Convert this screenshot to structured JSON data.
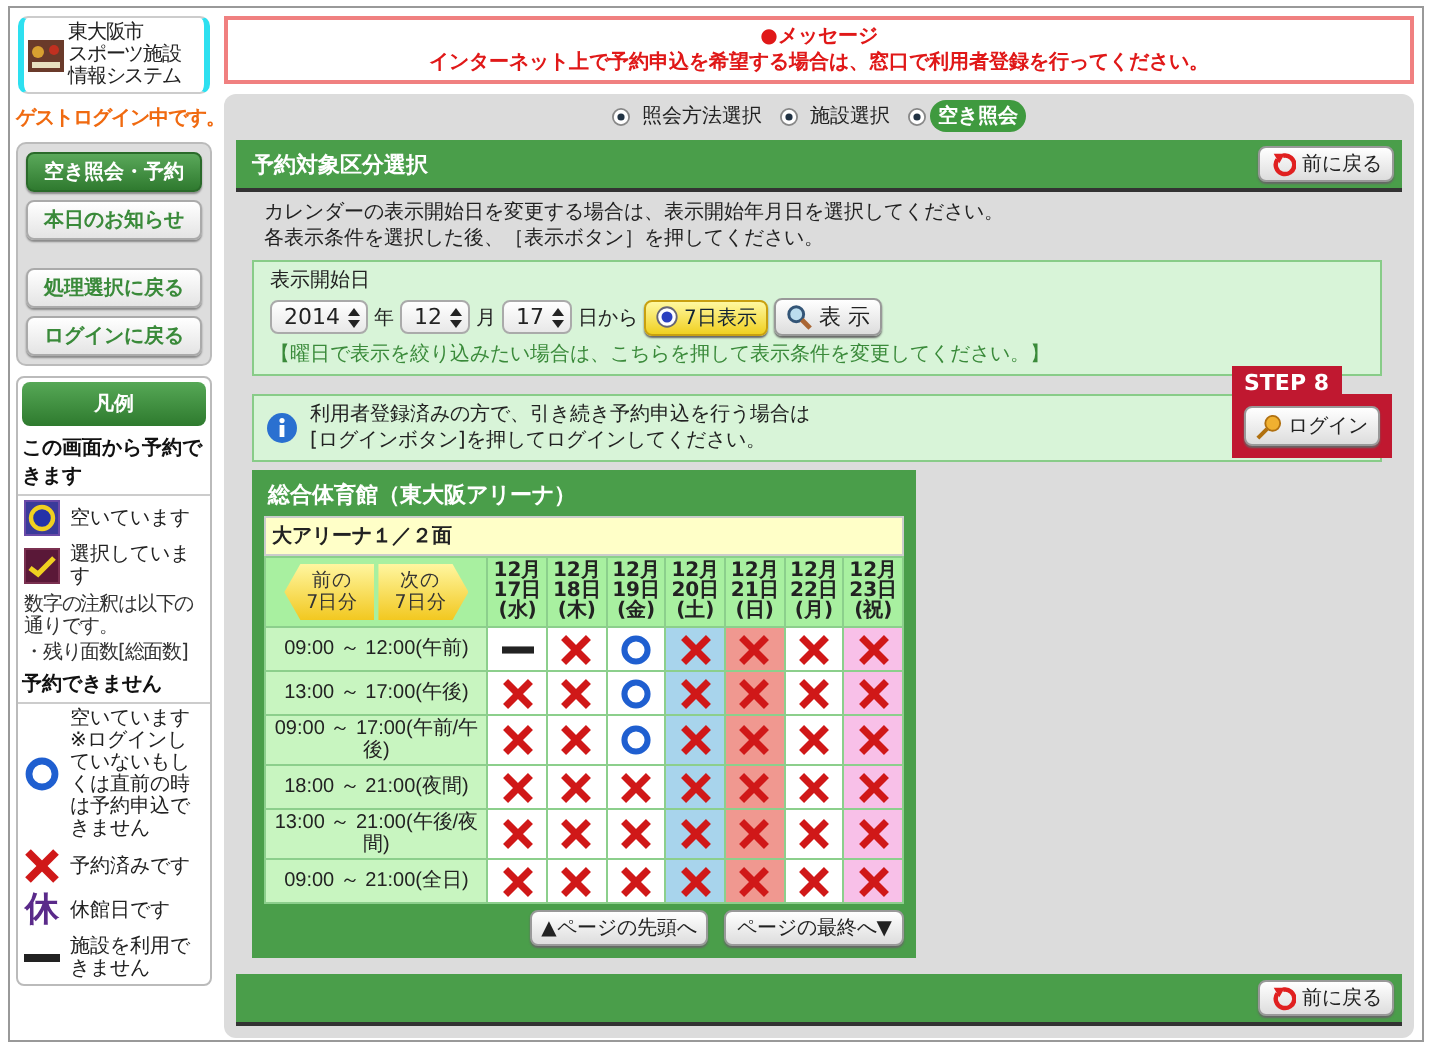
{
  "logo": {
    "lines": [
      "東大阪市",
      "スポーツ施設",
      "情報システム"
    ]
  },
  "guest_status": "ゲストログイン中です。",
  "nav_groups": [
    [
      {
        "label": "空き照会・予約",
        "selected": true
      },
      {
        "label": "本日のお知らせ",
        "selected": false
      }
    ],
    [
      {
        "label": "処理選択に戻る",
        "selected": false
      },
      {
        "label": "ログインに戻る",
        "selected": false
      }
    ]
  ],
  "legend": {
    "title": "凡例",
    "sections": [
      {
        "heading": "この画面から予約できます",
        "items": [
          {
            "kind": "vacant_box",
            "text": "空いています"
          },
          {
            "kind": "selected_box",
            "text": "選択しています"
          }
        ],
        "notes": [
          "数字の注釈は以下の通りです。",
          "・残り面数[総面数]"
        ]
      },
      {
        "heading": "予約できません",
        "items": [
          {
            "kind": "circle",
            "text": "空いています ※ログインしていないもしくは直前の時は予約申込できません"
          },
          {
            "kind": "cross",
            "text": "予約済みです"
          },
          {
            "kind": "closed",
            "symbol": "休",
            "text": "休館日です"
          },
          {
            "kind": "dash",
            "text": "施設を利用できません"
          }
        ]
      }
    ]
  },
  "message": {
    "title": "●メッセージ",
    "text": "インターネット上で予約申込を希望する場合は、窓口で利用者登録を行ってください。"
  },
  "steps": [
    {
      "label": "照会方法選択",
      "selected": false
    },
    {
      "label": "施設選択",
      "selected": false
    },
    {
      "label": "空き照会",
      "selected": true
    }
  ],
  "section_title": "予約対象区分選択",
  "back_button": "前に戻る",
  "instructions": [
    "カレンダーの表示開始日を変更する場合は、表示開始年月日を選択してください。",
    "各表示条件を選択した後、［表示ボタン］を押してください。"
  ],
  "date_form": {
    "label": "表示開始日",
    "year": "2014",
    "year_unit": "年",
    "month": "12",
    "month_unit": "月",
    "day": "17",
    "day_unit": "日から",
    "mode_button": "7日表示",
    "mode_selected": true,
    "show_button": "表 示",
    "filter_link": "【曜日で表示を絞り込みたい場合は、こちらを押して表示条件を変更してください。】"
  },
  "login_notice": {
    "lines": [
      "利用者登録済みの方で、引き続き予約申込を行う場合は",
      "[ログインボタン]を押してログインしてください。"
    ],
    "step_badge": "STEP 8",
    "login_button": "ログイン"
  },
  "calendar": {
    "facility": "総合体育館（東大阪アリーナ）",
    "room": "大アリーナ１／２面",
    "prev_button": [
      "前の",
      "7日分"
    ],
    "next_button": [
      "次の",
      "7日分"
    ],
    "days": [
      {
        "month": "12月",
        "day": "17日",
        "weekday": "(水)",
        "kind": "weekday"
      },
      {
        "month": "12月",
        "day": "18日",
        "weekday": "(木)",
        "kind": "weekday"
      },
      {
        "month": "12月",
        "day": "19日",
        "weekday": "(金)",
        "kind": "weekday"
      },
      {
        "month": "12月",
        "day": "20日",
        "weekday": "(土)",
        "kind": "saturday"
      },
      {
        "month": "12月",
        "day": "21日",
        "weekday": "(日)",
        "kind": "sunday"
      },
      {
        "month": "12月",
        "day": "22日",
        "weekday": "(月)",
        "kind": "weekday"
      },
      {
        "month": "12月",
        "day": "23日",
        "weekday": "(祝)",
        "kind": "holiday"
      }
    ],
    "rows": [
      {
        "time": "09:00 ～ 12:00(午前)",
        "cells": [
          {
            "kind": "dash"
          },
          {
            "kind": "cross"
          },
          {
            "kind": "circle"
          },
          {
            "kind": "cross"
          },
          {
            "kind": "cross"
          },
          {
            "kind": "cross"
          },
          {
            "kind": "cross"
          }
        ]
      },
      {
        "time": "13:00 ～ 17:00(午後)",
        "cells": [
          {
            "kind": "cross"
          },
          {
            "kind": "cross"
          },
          {
            "kind": "circle"
          },
          {
            "kind": "cross"
          },
          {
            "kind": "cross"
          },
          {
            "kind": "cross"
          },
          {
            "kind": "cross"
          }
        ]
      },
      {
        "time": "09:00 ～ 17:00(午前/午後)",
        "cells": [
          {
            "kind": "cross"
          },
          {
            "kind": "cross"
          },
          {
            "kind": "circle"
          },
          {
            "kind": "cross"
          },
          {
            "kind": "cross"
          },
          {
            "kind": "cross"
          },
          {
            "kind": "cross"
          }
        ]
      },
      {
        "time": "18:00 ～ 21:00(夜間)",
        "cells": [
          {
            "kind": "cross"
          },
          {
            "kind": "cross"
          },
          {
            "kind": "cross"
          },
          {
            "kind": "cross"
          },
          {
            "kind": "cross"
          },
          {
            "kind": "cross"
          },
          {
            "kind": "cross"
          }
        ]
      },
      {
        "time": "13:00 ～ 21:00(午後/夜間)",
        "cells": [
          {
            "kind": "cross"
          },
          {
            "kind": "cross"
          },
          {
            "kind": "cross"
          },
          {
            "kind": "cross"
          },
          {
            "kind": "cross"
          },
          {
            "kind": "cross"
          },
          {
            "kind": "cross"
          }
        ]
      },
      {
        "time": "09:00 ～ 21:00(全日)",
        "cells": [
          {
            "kind": "cross"
          },
          {
            "kind": "cross"
          },
          {
            "kind": "cross"
          },
          {
            "kind": "cross"
          },
          {
            "kind": "cross"
          },
          {
            "kind": "cross"
          },
          {
            "kind": "cross"
          }
        ]
      }
    ],
    "top_button": "▲ページの先頭へ",
    "bottom_button": "ページの最終へ▼"
  },
  "footer_back_button": "前に戻る"
}
